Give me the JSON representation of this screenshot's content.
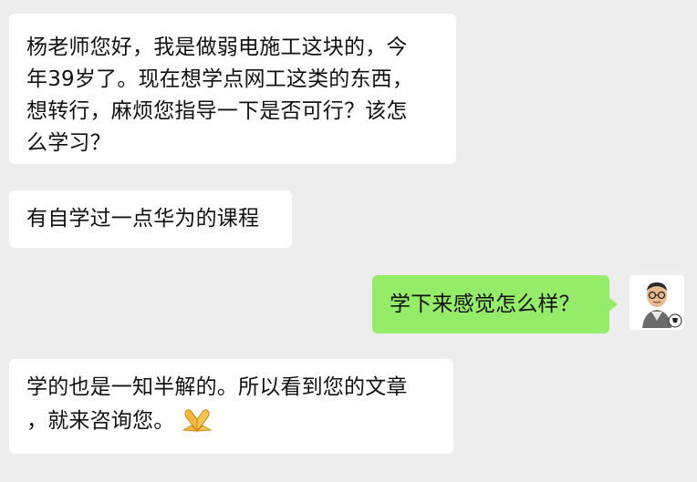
{
  "messages": [
    {
      "side": "incoming",
      "lines": [
        "杨老师您好，我是做弱电施工这块的，今",
        "年39岁了。现在想学点网工这类的东西，",
        "想转行，麻烦您指导一下是否可行？该怎",
        "么学习？"
      ]
    },
    {
      "side": "incoming",
      "lines": [
        "有自学过一点华为的课程"
      ]
    },
    {
      "side": "outgoing",
      "lines": [
        "学下来感觉怎么样？"
      ]
    },
    {
      "side": "incoming",
      "lines": [
        "学的也是一知半解的。所以看到您的文章",
        "，就来咨询您。"
      ],
      "emoji": "folded-hands"
    }
  ],
  "colors": {
    "background": "#ededed",
    "incoming_bubble": "#ffffff",
    "outgoing_bubble": "#95ec69"
  },
  "icons": {
    "avatar": "cartoon-man-avatar",
    "emoji": "folded-hands-emoji"
  }
}
